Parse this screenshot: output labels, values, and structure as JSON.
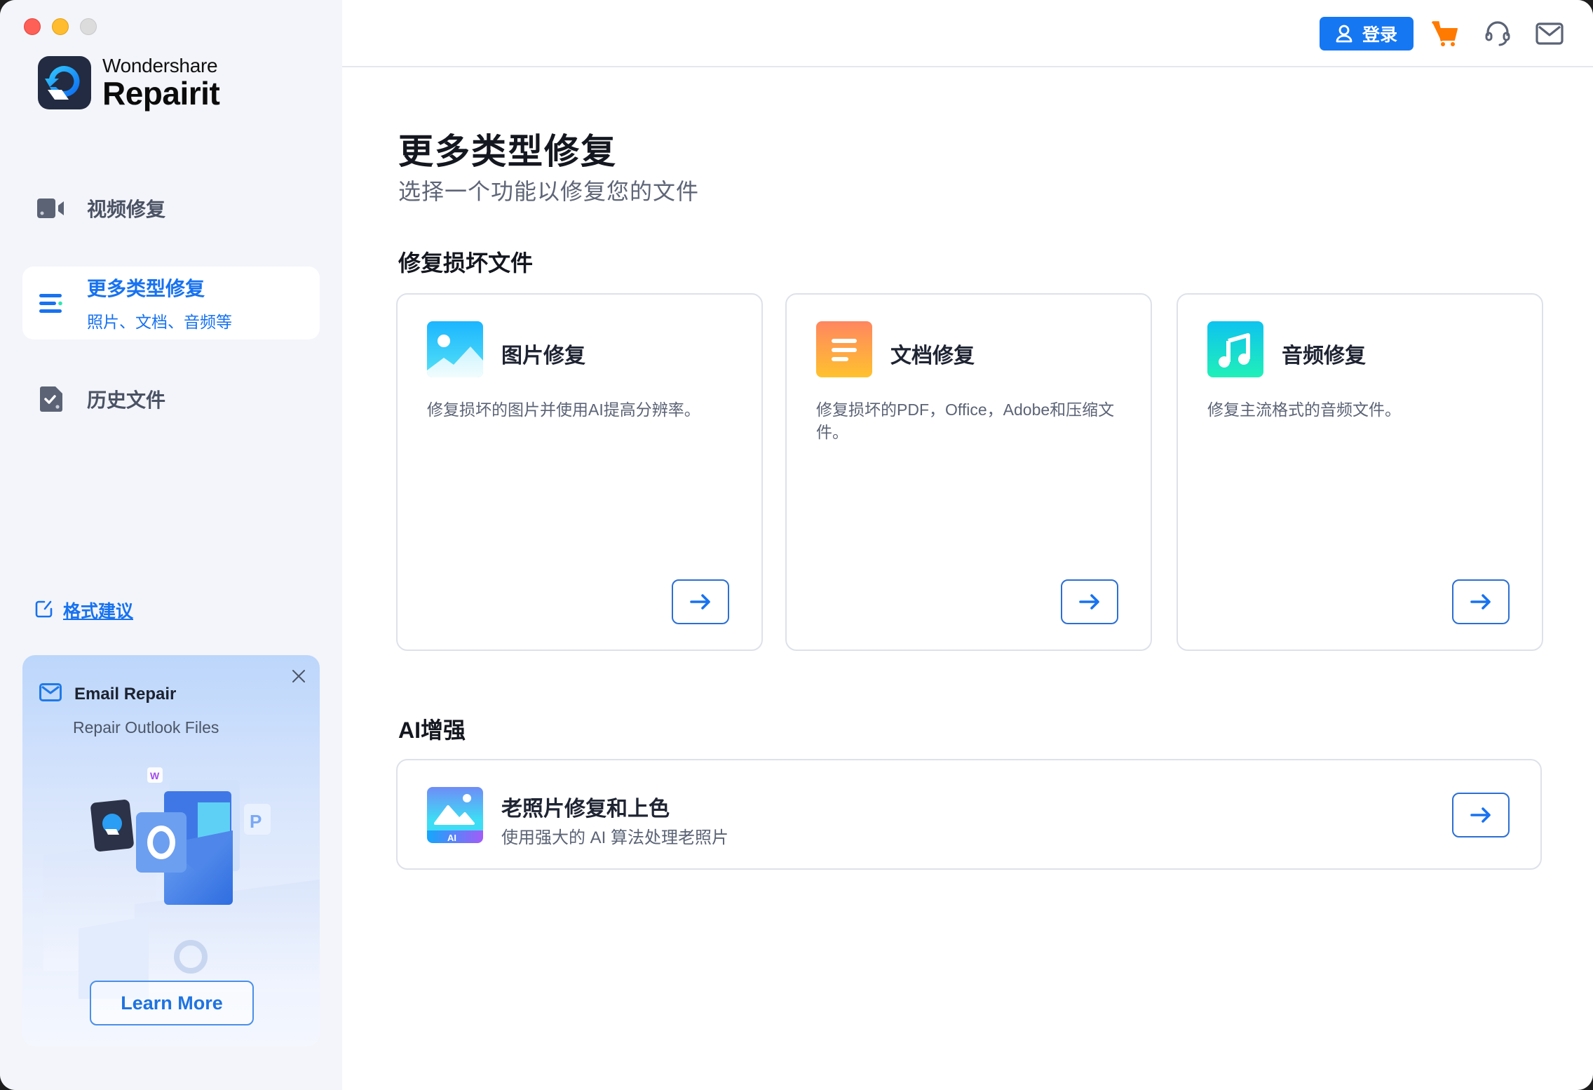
{
  "app": {
    "brand": "Wondershare",
    "product": "Repairit"
  },
  "sidebar": {
    "items": [
      {
        "label": "视频修复",
        "icon": "video-camera-icon"
      },
      {
        "label": "更多类型修复",
        "sub": "照片、文档、音频等",
        "icon": "list-icon",
        "active": true
      },
      {
        "label": "历史文件",
        "icon": "history-file-icon"
      }
    ],
    "format_suggestion": "格式建议",
    "promo": {
      "title": "Email Repair",
      "subtitle": "Repair Outlook Files",
      "button": "Learn More"
    }
  },
  "header": {
    "login_label": "登录",
    "icons": [
      "cart-icon",
      "headset-icon",
      "mail-icon"
    ],
    "accent": "#1677f2",
    "cart_color": "#ff7a00"
  },
  "main": {
    "title": "更多类型修复",
    "subtitle": "选择一个功能以修复您的文件",
    "sections": [
      {
        "title": "修复损坏文件",
        "cards": [
          {
            "title": "图片修复",
            "desc": "修复损坏的图片并使用AI提高分辨率。",
            "icon": "image-icon"
          },
          {
            "title": "文档修复",
            "desc": "修复损坏的PDF，Office，Adobe和压缩文件。",
            "icon": "document-icon"
          },
          {
            "title": "音频修复",
            "desc": "修复主流格式的音频文件。",
            "icon": "music-note-icon"
          }
        ]
      },
      {
        "title": "AI增强",
        "cards": [
          {
            "title": "老照片修复和上色",
            "desc": "使用强大的 AI 算法处理老照片",
            "icon": "ai-photo-icon",
            "badge": "AI"
          }
        ]
      }
    ]
  }
}
